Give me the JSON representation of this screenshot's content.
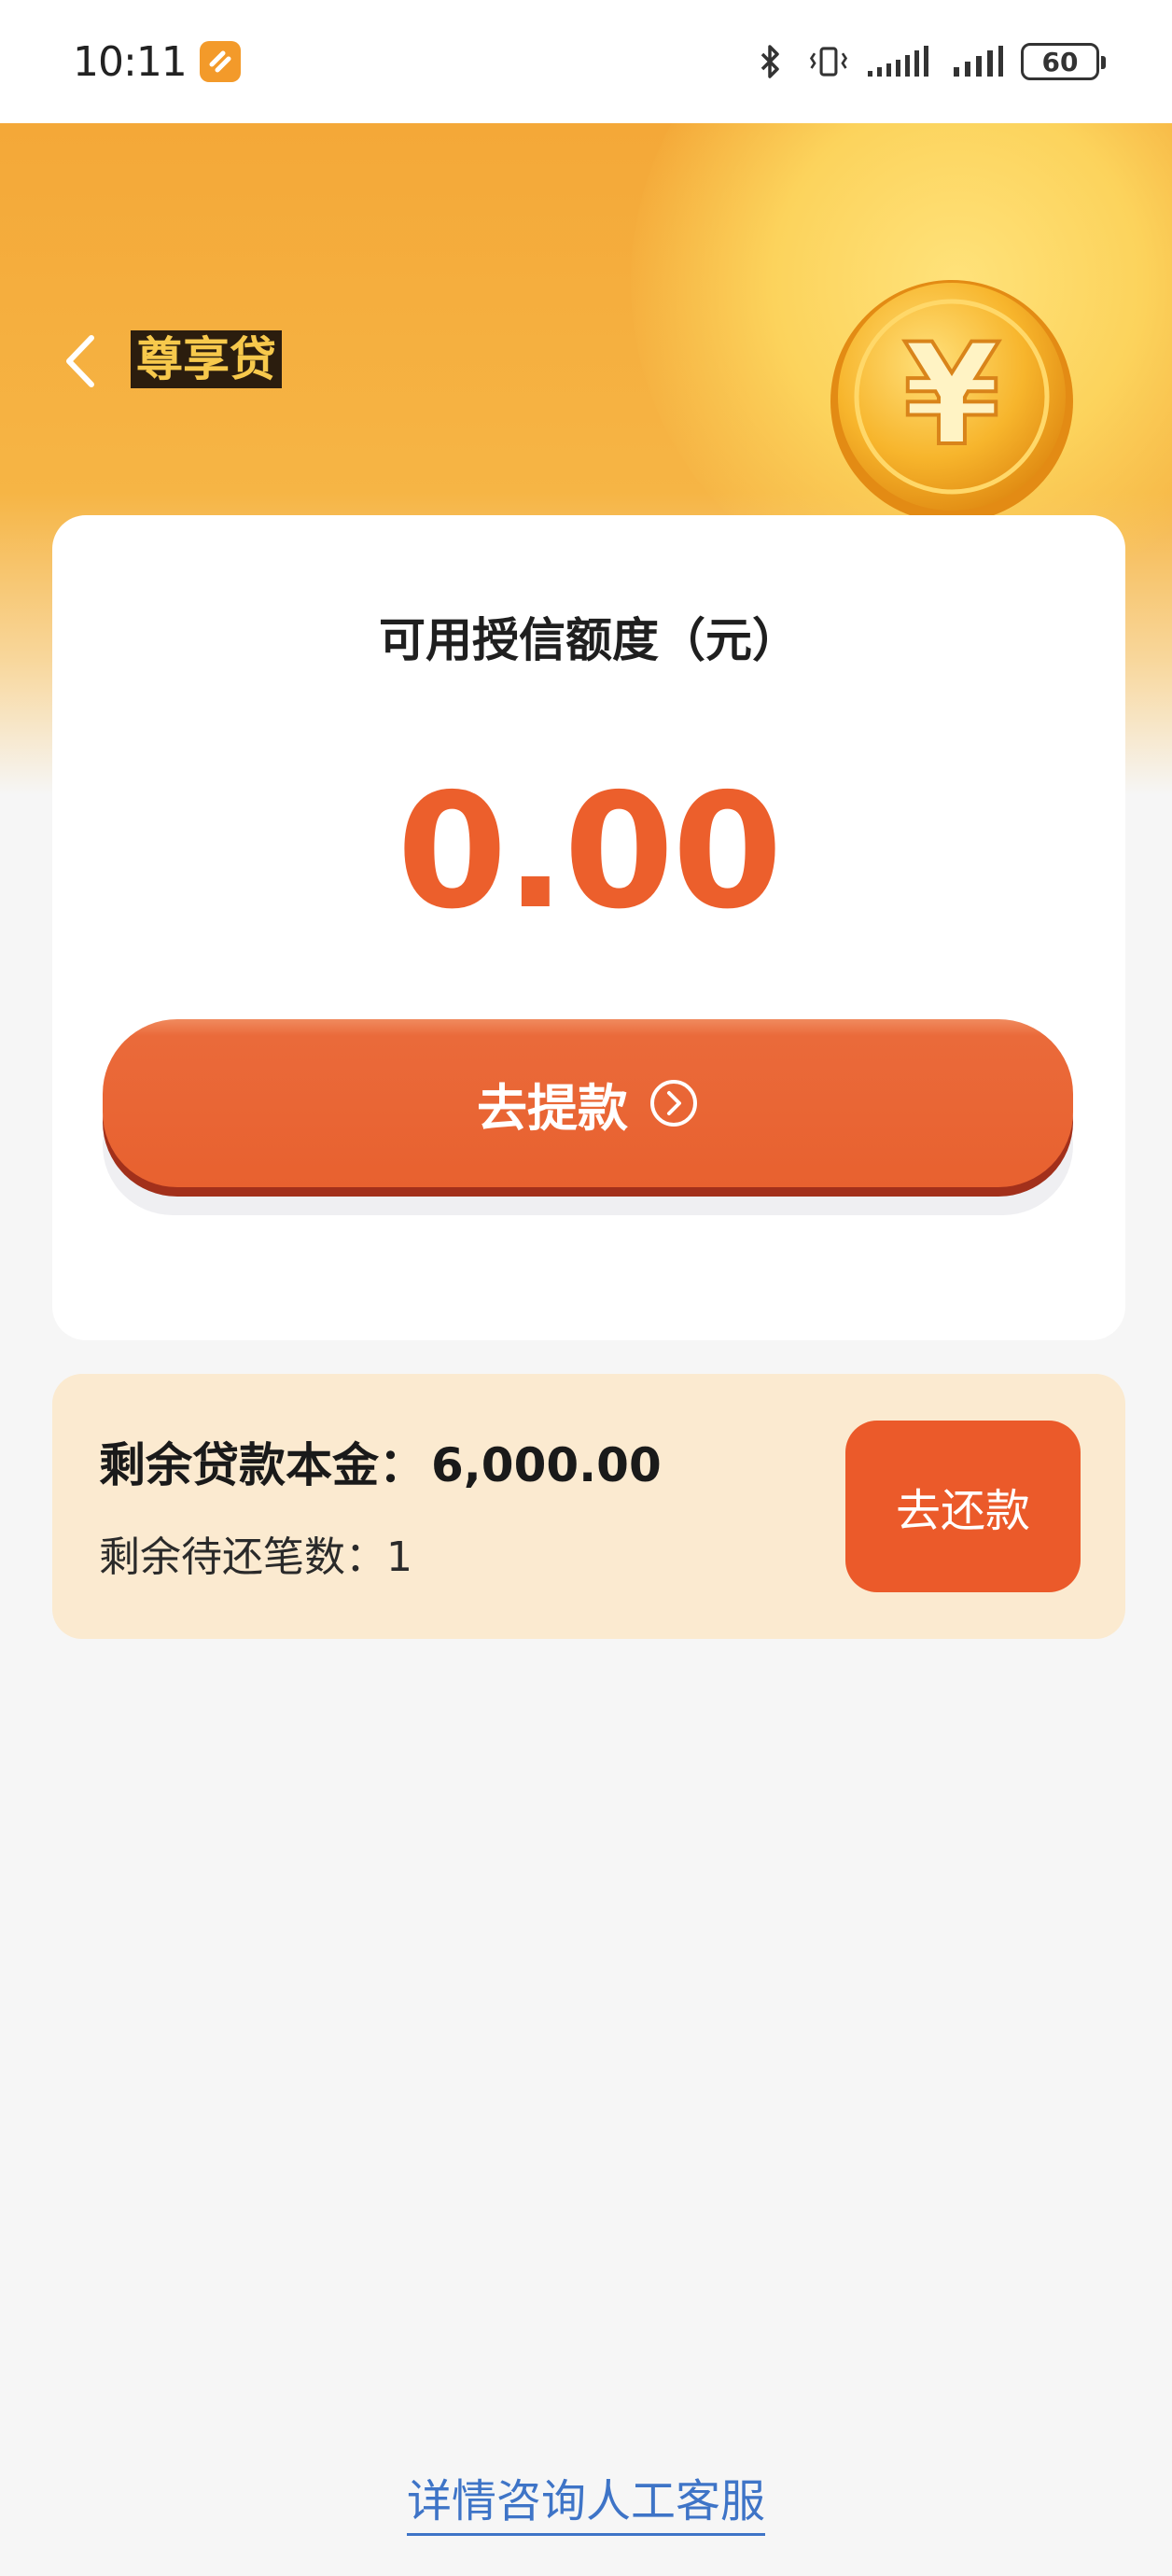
{
  "status_bar": {
    "time": "10:11",
    "battery": "60",
    "icons": [
      "app-notification-icon",
      "bluetooth-icon",
      "vibrate-icon",
      "signal-icon",
      "signal-icon",
      "battery-icon"
    ]
  },
  "header": {
    "title": "尊享贷",
    "back_icon": "chevron-left-icon",
    "coin_symbol": "¥"
  },
  "credit": {
    "label": "可用授信额度（元）",
    "amount": "0.00",
    "withdraw_label": "去提款",
    "withdraw_icon": "chevron-right-circle-icon"
  },
  "loan": {
    "principal_label": "剩余贷款本金：",
    "principal_value": "6,000.00",
    "count_label": "剩余待还笔数：",
    "count_value": "1",
    "repay_label": "去还款"
  },
  "footer": {
    "service_link": "详情咨询人工客服"
  },
  "colors": {
    "accent": "#eb5a2a",
    "header": "#f4a838",
    "loan_bg": "#fbead0",
    "link": "#3e74c7"
  }
}
